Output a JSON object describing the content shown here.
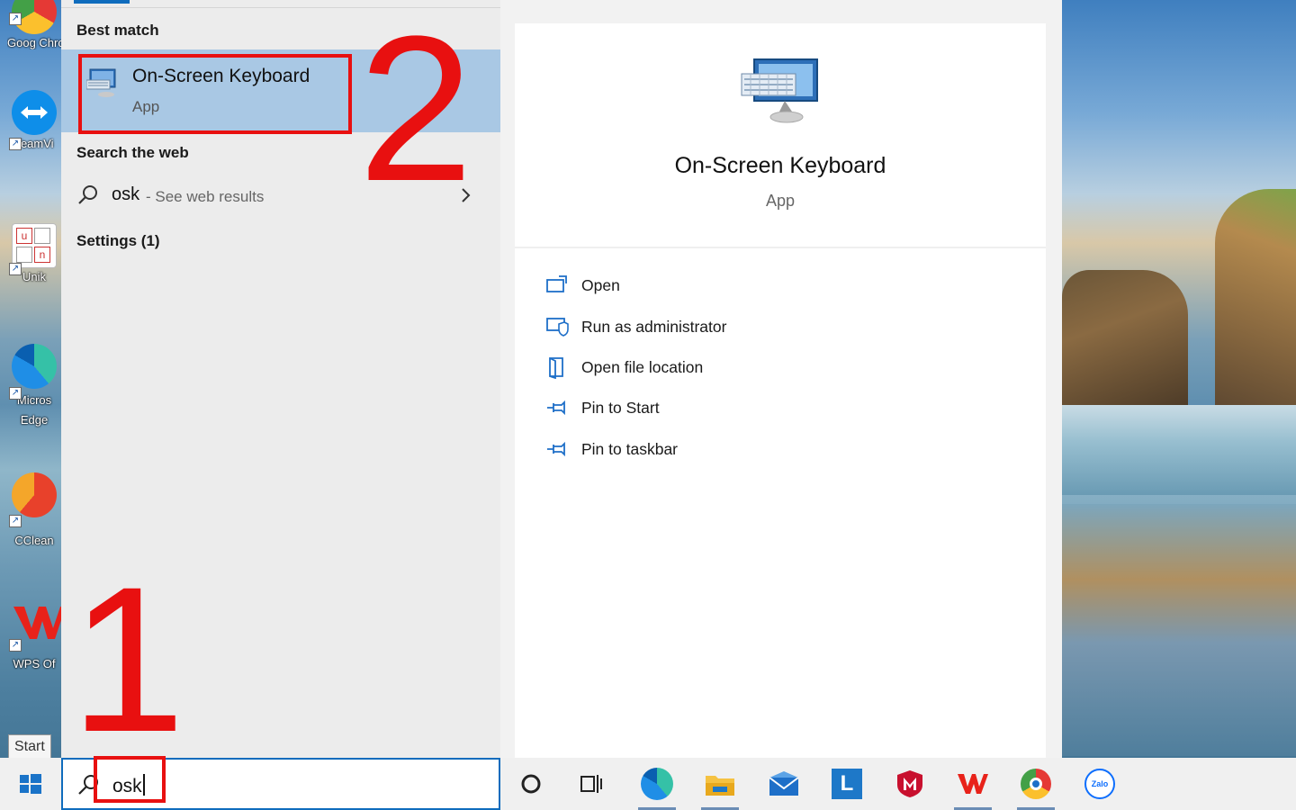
{
  "desktop": {
    "icons": [
      {
        "label": "Goog Chron",
        "icon": "chrome-icon"
      },
      {
        "label": "TeamVi",
        "icon": "teamviewer-icon"
      },
      {
        "label": "Unik",
        "icon": "unikey-icon"
      },
      {
        "label": "Micros Edge",
        "icon": "edge-icon"
      },
      {
        "label": "CClean",
        "icon": "ccleaner-icon"
      },
      {
        "label": "WPS Of",
        "icon": "wps-office-icon"
      }
    ]
  },
  "search_panel": {
    "best_match_title": "Best match",
    "best_match": {
      "name": "On-Screen Keyboard",
      "type": "App",
      "icon": "keyboard-monitor-icon"
    },
    "web_title": "Search the web",
    "web_result": {
      "query": "osk",
      "hint": "- See web results"
    },
    "settings_title": "Settings (1)"
  },
  "detail": {
    "name": "On-Screen Keyboard",
    "type": "App",
    "actions": [
      {
        "label": "Open",
        "icon": "open-window-icon"
      },
      {
        "label": "Run as administrator",
        "icon": "shield-admin-icon"
      },
      {
        "label": "Open file location",
        "icon": "file-location-icon"
      },
      {
        "label": "Pin to Start",
        "icon": "pin-icon"
      },
      {
        "label": "Pin to taskbar",
        "icon": "pin-icon"
      }
    ]
  },
  "annotations": {
    "step1": "1",
    "step2": "2",
    "accent": "#e81010"
  },
  "tooltip": "Start",
  "taskbar": {
    "search_value": "osk",
    "items": [
      "cortana-icon",
      "task-view-icon",
      "edge-icon",
      "file-explorer-icon",
      "mail-icon",
      "lingoes-icon",
      "mcafee-icon",
      "wps-office-icon",
      "chrome-icon",
      "zalo-icon"
    ],
    "zalo_label": "Zalo"
  },
  "colors": {
    "accent": "#0f6cbd",
    "selection": "#a9c8e4"
  }
}
